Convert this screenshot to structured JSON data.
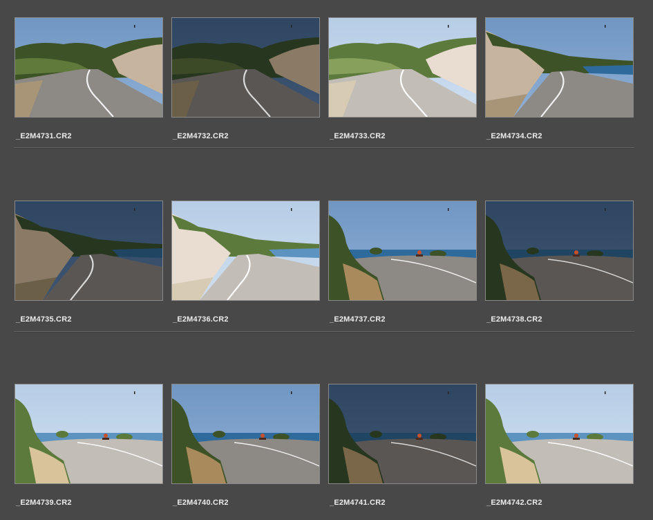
{
  "photos": [
    {
      "filename": "_E2M4731.CR2",
      "scene": "road-hills",
      "tone": "normal"
    },
    {
      "filename": "_E2M4732.CR2",
      "scene": "road-hills",
      "tone": "dark"
    },
    {
      "filename": "_E2M4733.CR2",
      "scene": "road-hills",
      "tone": "bright"
    },
    {
      "filename": "_E2M4734.CR2",
      "scene": "road-bay",
      "tone": "normal"
    },
    {
      "filename": "_E2M4735.CR2",
      "scene": "road-bay",
      "tone": "dark"
    },
    {
      "filename": "_E2M4736.CR2",
      "scene": "road-bay",
      "tone": "bright"
    },
    {
      "filename": "_E2M4737.CR2",
      "scene": "coast-rider",
      "tone": "normal"
    },
    {
      "filename": "_E2M4738.CR2",
      "scene": "coast-rider",
      "tone": "dark"
    },
    {
      "filename": "_E2M4739.CR2",
      "scene": "coast-rider",
      "tone": "bright"
    },
    {
      "filename": "_E2M4740.CR2",
      "scene": "coast-rider",
      "tone": "normal"
    },
    {
      "filename": "_E2M4741.CR2",
      "scene": "coast-rider",
      "tone": "dark"
    },
    {
      "filename": "_E2M4742.CR2",
      "scene": "coast-rider",
      "tone": "bright"
    }
  ],
  "colors": {
    "background": "#484848",
    "thumbnail_border": "#8a8a8a",
    "filename_text": "#ececec",
    "separator": "#646464"
  }
}
